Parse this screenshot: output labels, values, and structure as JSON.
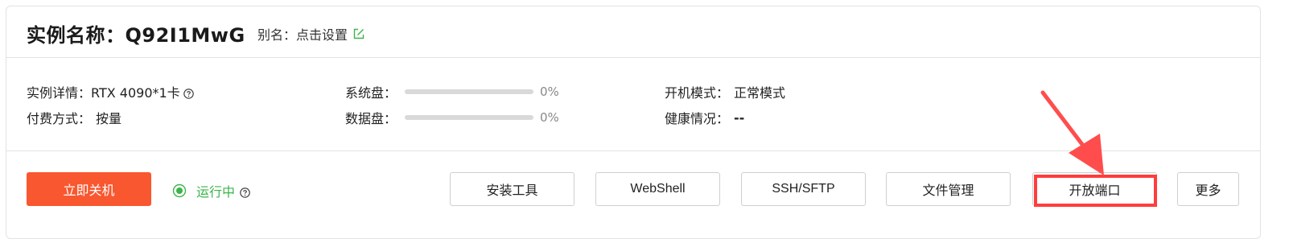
{
  "header": {
    "title": "实例名称：Q92I1MwG",
    "alias_label": "别名：点击设置"
  },
  "details": {
    "instance_detail_label": "实例详情：",
    "instance_detail_value": "RTX 4090*1卡",
    "billing_label": "付费方式：",
    "billing_value": "按量",
    "system_disk_label": "系统盘：",
    "system_disk_pct": "0%",
    "system_disk_fraction": 0,
    "data_disk_label": "数据盘：",
    "data_disk_pct": "0%",
    "data_disk_fraction": 0,
    "boot_mode_label": "开机模式：",
    "boot_mode_value": "正常模式",
    "health_label": "健康情况：",
    "health_value": "--"
  },
  "actions": {
    "shutdown_label": "立即关机",
    "status_label": "运行中",
    "install_tools_label": "安装工具",
    "webshell_label": "WebShell",
    "ssh_sftp_label": "SSH/SFTP",
    "file_manager_label": "文件管理",
    "open_port_label": "开放端口",
    "more_label": "更多"
  },
  "icons": {
    "edit": "edit-icon",
    "help": "help-icon",
    "status": "radio-checked-icon"
  },
  "colors": {
    "primary": "#f9572f",
    "status_green": "#3bb54a",
    "annotation_red": "#ff3d3d"
  }
}
